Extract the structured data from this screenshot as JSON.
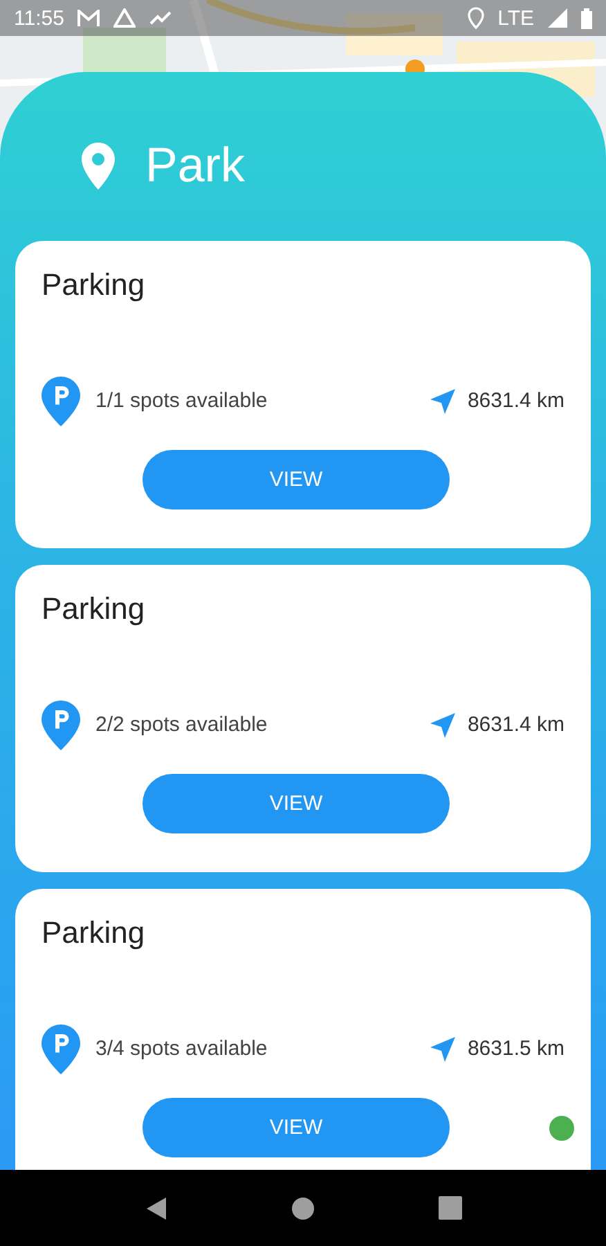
{
  "status_bar": {
    "time": "11:55",
    "network": "LTE"
  },
  "sheet": {
    "title": "Park"
  },
  "parkings": [
    {
      "name": "Parking",
      "spots": "1/1 spots available",
      "distance": "8631.4 km",
      "action": "VIEW"
    },
    {
      "name": "Parking",
      "spots": "2/2 spots available",
      "distance": "8631.4 km",
      "action": "VIEW"
    },
    {
      "name": "Parking",
      "spots": "3/4 spots available",
      "distance": "8631.5 km",
      "action": "VIEW"
    }
  ]
}
